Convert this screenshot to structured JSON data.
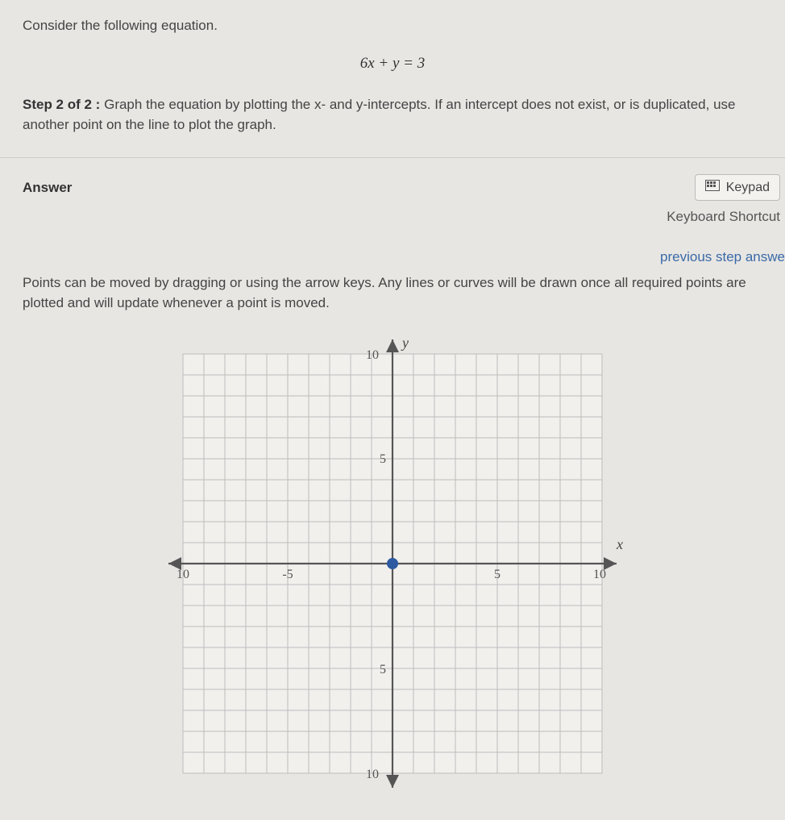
{
  "question": {
    "prompt": "Consider the following equation.",
    "equation": "6x + y = 3",
    "step_label": "Step 2 of 2 :",
    "step_text": "Graph the equation by plotting the x- and y-intercepts.  If an intercept does not exist, or is duplicated, use another point on the line to plot the graph."
  },
  "answer_section": {
    "label": "Answer",
    "keypad_button": "Keypad",
    "keyboard_shortcut": "Keyboard Shortcut",
    "previous_step": "previous step answe"
  },
  "instructions": "Points can be moved by dragging or using the arrow keys. Any lines or curves will be drawn once all required points are plotted and will update whenever a point is moved.",
  "graph": {
    "x_axis_label": "x",
    "y_axis_label": "y",
    "ticks": {
      "neg10": "10",
      "neg5": "-5",
      "pos5": "5",
      "pos10": "10",
      "y_pos10": "10",
      "y_pos5": "5",
      "y_neg5": "5",
      "y_neg10": "10"
    },
    "xmin": -10,
    "xmax": 10,
    "ymin": -10,
    "ymax": 10,
    "plotted_points": [
      {
        "x": 0,
        "y": 0
      }
    ]
  },
  "chart_data": {
    "type": "scatter",
    "title": "",
    "xlabel": "x",
    "ylabel": "y",
    "xlim": [
      -10,
      10
    ],
    "ylim": [
      -10,
      10
    ],
    "series": [
      {
        "name": "plotted-point",
        "x": [
          0
        ],
        "y": [
          0
        ]
      }
    ]
  }
}
